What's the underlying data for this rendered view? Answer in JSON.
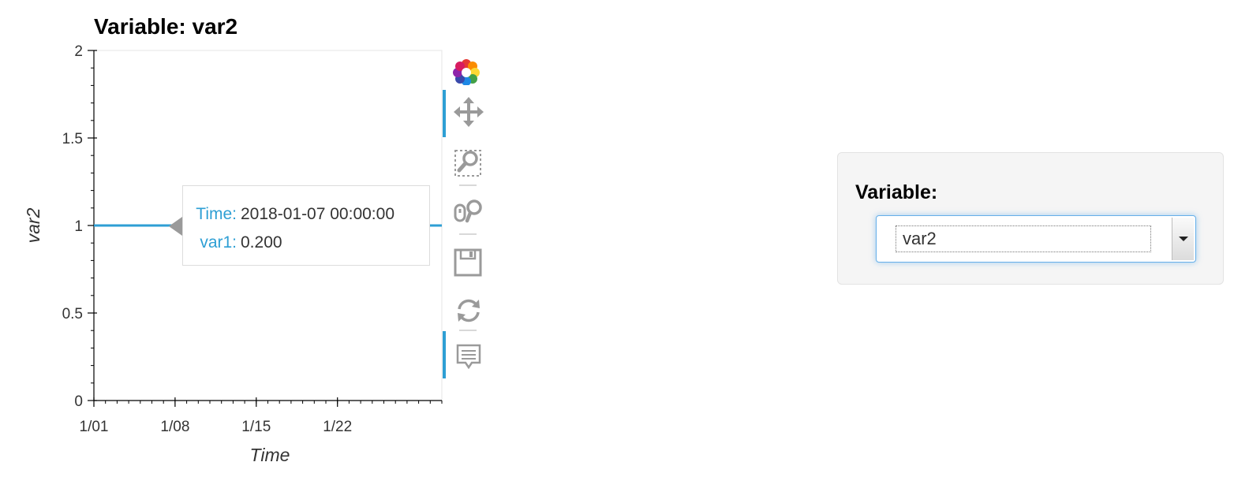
{
  "plot": {
    "title": "Variable: var2"
  },
  "chart_data": {
    "type": "line",
    "title": "Variable: var2",
    "xlabel": "Time",
    "ylabel": "var2",
    "x_tick_labels": [
      "1/01",
      "1/08",
      "1/15",
      "1/22"
    ],
    "x_tick_dates": [
      "2018-01-01",
      "2018-01-08",
      "2018-01-15",
      "2018-01-22"
    ],
    "xlim": [
      "2018-01-01",
      "2018-01-31"
    ],
    "y_tick_labels": [
      "0",
      "0.5",
      "1",
      "1.5",
      "2"
    ],
    "y_ticks": [
      0,
      0.5,
      1,
      1.5,
      2
    ],
    "ylim": [
      0,
      2
    ],
    "grid": false,
    "series": [
      {
        "color": "#2e9fd4",
        "x": [
          "2018-01-01",
          "2018-01-31"
        ],
        "y": [
          1,
          1
        ]
      }
    ]
  },
  "tooltip": {
    "rows": [
      {
        "key": "Time:",
        "value": "2018-01-07 00:00:00"
      },
      {
        "key": "var1:",
        "value": "0.200"
      }
    ]
  },
  "toolbar": {
    "tools": [
      {
        "icon": "bokeh-logo-icon",
        "active": false
      },
      {
        "icon": "pan-icon",
        "active": true
      },
      {
        "icon": "box-zoom-icon",
        "active": false
      },
      {
        "icon": "wheel-zoom-icon",
        "active": false
      },
      {
        "icon": "save-icon",
        "active": false
      },
      {
        "icon": "reset-icon",
        "active": false
      },
      {
        "icon": "hover-icon",
        "active": true
      }
    ]
  },
  "widget": {
    "label": "Variable:",
    "select": {
      "value": "var2"
    }
  },
  "colors": {
    "accent": "#2e9fd4",
    "axis": "#333333",
    "tooltip_key": "#2e9fd4",
    "focus_border": "#66afe9"
  }
}
